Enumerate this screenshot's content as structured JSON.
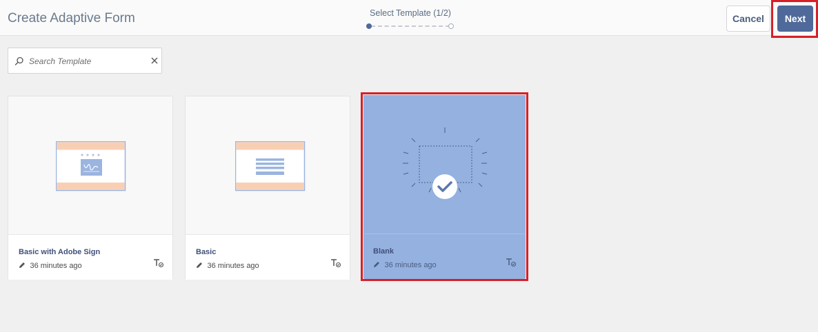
{
  "header": {
    "title": "Create Adaptive Form",
    "step_label": "Select Template (1/2)",
    "cancel_label": "Cancel",
    "next_label": "Next"
  },
  "search": {
    "placeholder": "Search Template",
    "value": ""
  },
  "templates": [
    {
      "name": "Basic with Adobe Sign",
      "modified": "36 minutes ago",
      "selected": false,
      "thumbnail": "form-with-signature-icon"
    },
    {
      "name": "Basic",
      "modified": "36 minutes ago",
      "selected": false,
      "thumbnail": "basic-form-icon"
    },
    {
      "name": "Blank",
      "modified": "36 minutes ago",
      "selected": true,
      "thumbnail": "blank-form-check-icon"
    }
  ],
  "colors": {
    "accent": "#4f6a9a",
    "selected_card": "#94b1e0",
    "highlight_outline": "#d71f27",
    "thumb_band": "#f9cfb4",
    "thumb_frame": "#9bb4e0"
  }
}
